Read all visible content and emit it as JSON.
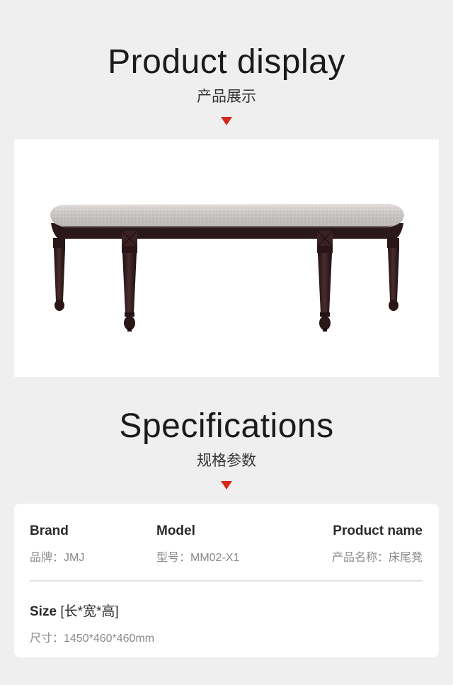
{
  "display_section": {
    "title_en": "Product display",
    "title_cn": "产品展示",
    "marker_icon": "down-triangle-icon",
    "photo_label": "bed-end-bench-photo"
  },
  "specs_section": {
    "title_en": "Specifications",
    "title_cn": "规格参数",
    "marker_icon": "down-triangle-icon",
    "brand": {
      "label": "Brand",
      "value": "品牌：JMJ"
    },
    "model": {
      "label": "Model",
      "value": "型号：MM02-X1"
    },
    "product_name": {
      "label": "Product name",
      "value": "产品名称：床尾凳"
    },
    "size": {
      "label": "Size",
      "label_cn": "[长*宽*高]",
      "value": "尺寸：1450*460*460mm"
    }
  },
  "colors": {
    "accent": "#d6281b",
    "background": "#efefef",
    "card": "#ffffff",
    "frame_wood": "#2e1a1c",
    "cushion": "#d8d3d0"
  }
}
